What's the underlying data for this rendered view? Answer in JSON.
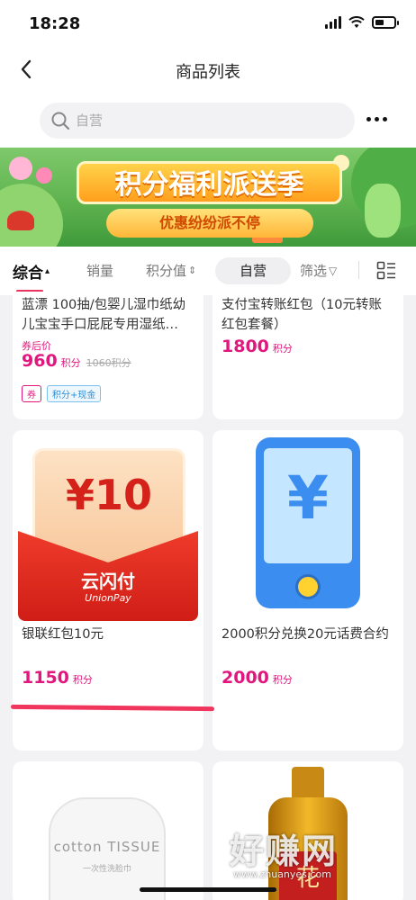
{
  "status_bar": {
    "time": "18:28"
  },
  "nav": {
    "title": "商品列表"
  },
  "search": {
    "placeholder": "自营"
  },
  "banner": {
    "title": "积分福利派送季",
    "subtitle": "优惠纷纷派不停"
  },
  "filters": {
    "items": [
      {
        "label": "综合",
        "suffix": "▴"
      },
      {
        "label": "销量",
        "suffix": ""
      },
      {
        "label": "积分值",
        "suffix": "⇕"
      },
      {
        "label": "自营",
        "suffix": ""
      },
      {
        "label": "筛选",
        "suffix": "▽"
      }
    ]
  },
  "products": [
    {
      "title_line1": "蓝漂 100抽/包婴儿湿巾纸幼",
      "title_line2": "儿宝宝手口屁屁专用湿纸…",
      "price_note": "券后价",
      "price": "960",
      "unit": "积分",
      "original_price": "1060积分",
      "tags": [
        "券",
        "积分+现金"
      ]
    },
    {
      "title_line1": "支付宝转账红包（10元转账",
      "title_line2": "红包套餐）",
      "price": "1800",
      "unit": "积分"
    },
    {
      "title_line1": "银联红包10元",
      "price": "1150",
      "unit": "积分",
      "image_amount": "¥10",
      "image_brand": "云闪付",
      "image_brand_en": "UnionPay"
    },
    {
      "title_line1": "2000积分兑换20元话费合约",
      "price": "2000",
      "unit": "积分",
      "image_symbol": "¥"
    },
    {
      "image_text": "cotton TISSUE",
      "image_subtext": "一次性洗脸巾"
    },
    {
      "image_text": "花"
    }
  ],
  "watermark": {
    "main": "好赚网",
    "sub": "www.zhuanyes.com"
  },
  "colors": {
    "price": "#e0187d",
    "accent": "#e83560",
    "banner_green": "#5fb34f"
  }
}
